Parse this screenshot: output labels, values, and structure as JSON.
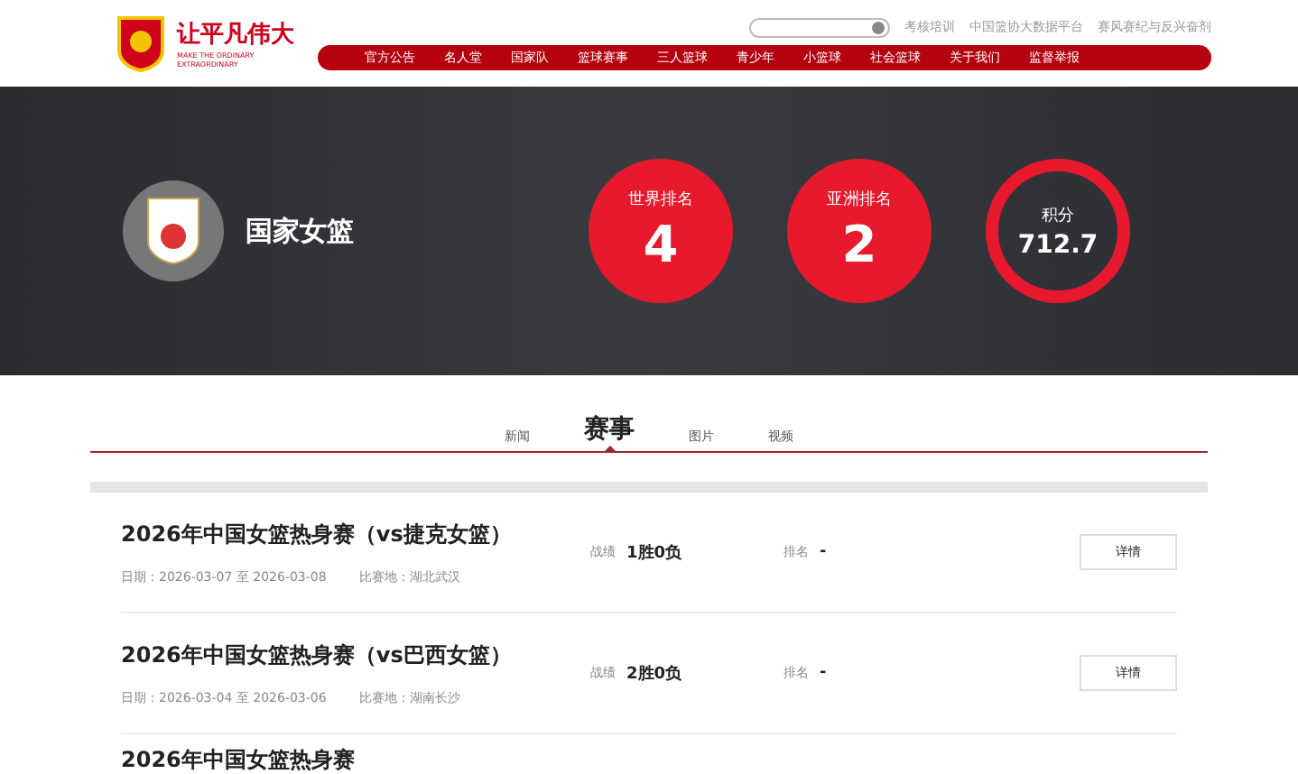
{
  "logo": {
    "slogan": "让平凡伟大",
    "slogan_en": "MAKE THE ORDINARY EXTRAORDINARY"
  },
  "top_links": [
    "考核培训",
    "中国篮协大数据平台",
    "赛风赛纪与反兴奋剂"
  ],
  "nav": [
    "官方公告",
    "名人堂",
    "国家队",
    "篮球赛事",
    "三人篮球",
    "青少年",
    "小篮球",
    "社会篮球",
    "关于我们",
    "监督举报"
  ],
  "hero": {
    "team": "国家女篮",
    "stats": [
      {
        "kind": "filled",
        "label": "世界排名",
        "value": "4"
      },
      {
        "kind": "filled",
        "label": "亚洲排名",
        "value": "2"
      },
      {
        "kind": "ring",
        "label": "积分",
        "value": "712.7"
      }
    ]
  },
  "tabs": [
    {
      "label": "新闻",
      "selected": false
    },
    {
      "label": "赛事",
      "selected": true
    },
    {
      "label": "图片",
      "selected": false
    },
    {
      "label": "视频",
      "selected": false
    }
  ],
  "events": [
    {
      "title": "2026年中国女篮热身赛（vs捷克女篮）",
      "date_label": "日期：",
      "date": "2026-03-07 至 2026-03-08",
      "venue_label": "比赛地：",
      "venue": "湖北武汉",
      "record_label": "战绩",
      "record": "1胜0负",
      "rank_label": "排名",
      "rank": "-",
      "button": "详情"
    },
    {
      "title": "2026年中国女篮热身赛（vs巴西女篮）",
      "date_label": "日期：",
      "date": "2026-03-04 至 2026-03-06",
      "venue_label": "比赛地：",
      "venue": "湖南长沙",
      "record_label": "战绩",
      "record": "2胜0负",
      "rank_label": "排名",
      "rank": "-",
      "button": "详情"
    },
    {
      "title": "2026年中国女篮热身赛"
    }
  ]
}
